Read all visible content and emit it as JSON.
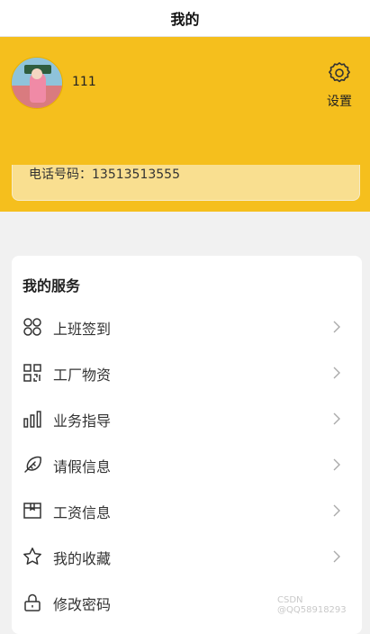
{
  "header": {
    "title": "我的"
  },
  "profile": {
    "username": "111",
    "phone_text": "电话号码：13513513555",
    "settings_label": "设置"
  },
  "services": {
    "title": "我的服务",
    "items": [
      {
        "label": "上班签到",
        "icon": "clover-icon"
      },
      {
        "label": "工厂物资",
        "icon": "qrcode-icon"
      },
      {
        "label": "业务指导",
        "icon": "bar-chart-icon"
      },
      {
        "label": "请假信息",
        "icon": "feather-icon"
      },
      {
        "label": "工资信息",
        "icon": "box-icon"
      },
      {
        "label": "我的收藏",
        "icon": "star-icon"
      },
      {
        "label": "修改密码",
        "icon": "lock-icon"
      }
    ]
  },
  "watermark": "CSDN @QQ58918293",
  "colors": {
    "accent": "#f5bf1d",
    "card": "#f9df90",
    "background": "#f1f1f1"
  }
}
